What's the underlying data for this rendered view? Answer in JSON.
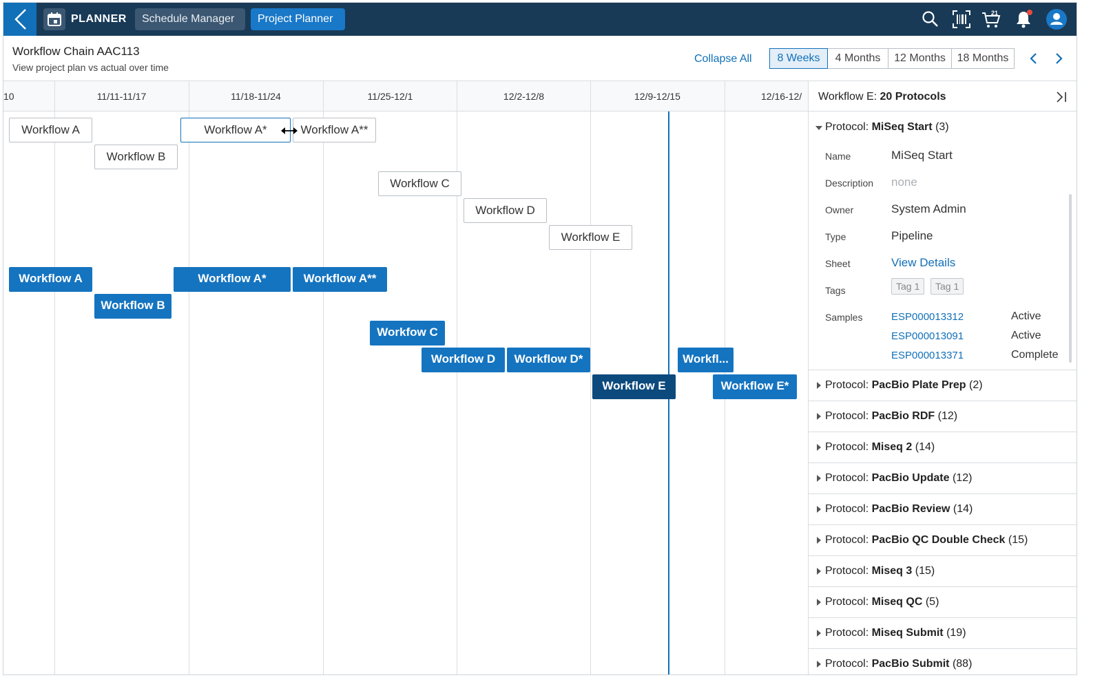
{
  "topbar": {
    "app_name": "PLANNER",
    "tabs": [
      {
        "label": "Schedule Manager",
        "active": false
      },
      {
        "label": "Project Planner",
        "active": true
      }
    ],
    "notification_dot_color": "#e74c3c"
  },
  "header": {
    "title": "Workflow Chain AAC113",
    "subtitle": "View project plan vs actual over time",
    "collapse_all": "Collapse All",
    "ranges": [
      {
        "label": "8 Weeks",
        "active": true
      },
      {
        "label": "4 Months",
        "active": false
      },
      {
        "label": "12 Months",
        "active": false
      },
      {
        "label": "18 Months",
        "active": false
      }
    ]
  },
  "timeline": {
    "weeks": [
      "10",
      "11/11-11/17",
      "11/18-11/24",
      "11/25-12/1",
      "12/2-12/8",
      "12/9-12/15",
      "12/16-12/"
    ],
    "plan_bars": [
      "Workflow A",
      "Workflow B",
      "Workflow A*",
      "Workflow A**",
      "Workflow C",
      "Workflow D",
      "Workflow E"
    ],
    "actual_bars": [
      "Workflow A",
      "Workflow B",
      "Workflow A*",
      "Workflow A**",
      "Workfow C",
      "Workflow D",
      "Workflow D*",
      "Workflow E",
      "Workfl...",
      "Workflow E*"
    ]
  },
  "panel": {
    "title_prefix": "Workflow E:",
    "title_count": "20 Protocols",
    "expanded": {
      "prefix": "Protocol:",
      "name": "MiSeq Start",
      "count": "(3)",
      "fields": {
        "name_label": "Name",
        "name_value": "MiSeq Start",
        "description_label": "Description",
        "description_value": "none",
        "owner_label": "Owner",
        "owner_value": "System Admin",
        "type_label": "Type",
        "type_value": "Pipeline",
        "sheet_label": "Sheet",
        "sheet_value": "View Details",
        "tags_label": "Tags",
        "samples_label": "Samples"
      },
      "tags": [
        "Tag 1",
        "Tag 1"
      ],
      "samples": [
        {
          "id": "ESP000013312",
          "status": "Active"
        },
        {
          "id": "ESP000013091",
          "status": "Active"
        },
        {
          "id": "ESP000013371",
          "status": "Complete"
        }
      ]
    },
    "protocols": [
      {
        "prefix": "Protocol:",
        "name": "PacBio Plate Prep",
        "count": "(2)"
      },
      {
        "prefix": "Protocol:",
        "name": "PacBio RDF",
        "count": "(12)"
      },
      {
        "prefix": "Protocol:",
        "name": "Miseq 2",
        "count": "(14)"
      },
      {
        "prefix": "Protocol:",
        "name": "PacBio Update",
        "count": "(12)"
      },
      {
        "prefix": "Protocol:",
        "name": "PacBio Review",
        "count": "(14)"
      },
      {
        "prefix": "Protocol:",
        "name": "PacBio QC Double Check",
        "count": "(15)"
      },
      {
        "prefix": "Protocol:",
        "name": "Miseq 3",
        "count": "(15)"
      },
      {
        "prefix": "Protocol:",
        "name": "Miseq QC",
        "count": "(5)"
      },
      {
        "prefix": "Protocol:",
        "name": "Miseq Submit",
        "count": "(19)"
      },
      {
        "prefix": "Protocol:",
        "name": "PacBio Submit",
        "count": "(88)"
      }
    ]
  }
}
